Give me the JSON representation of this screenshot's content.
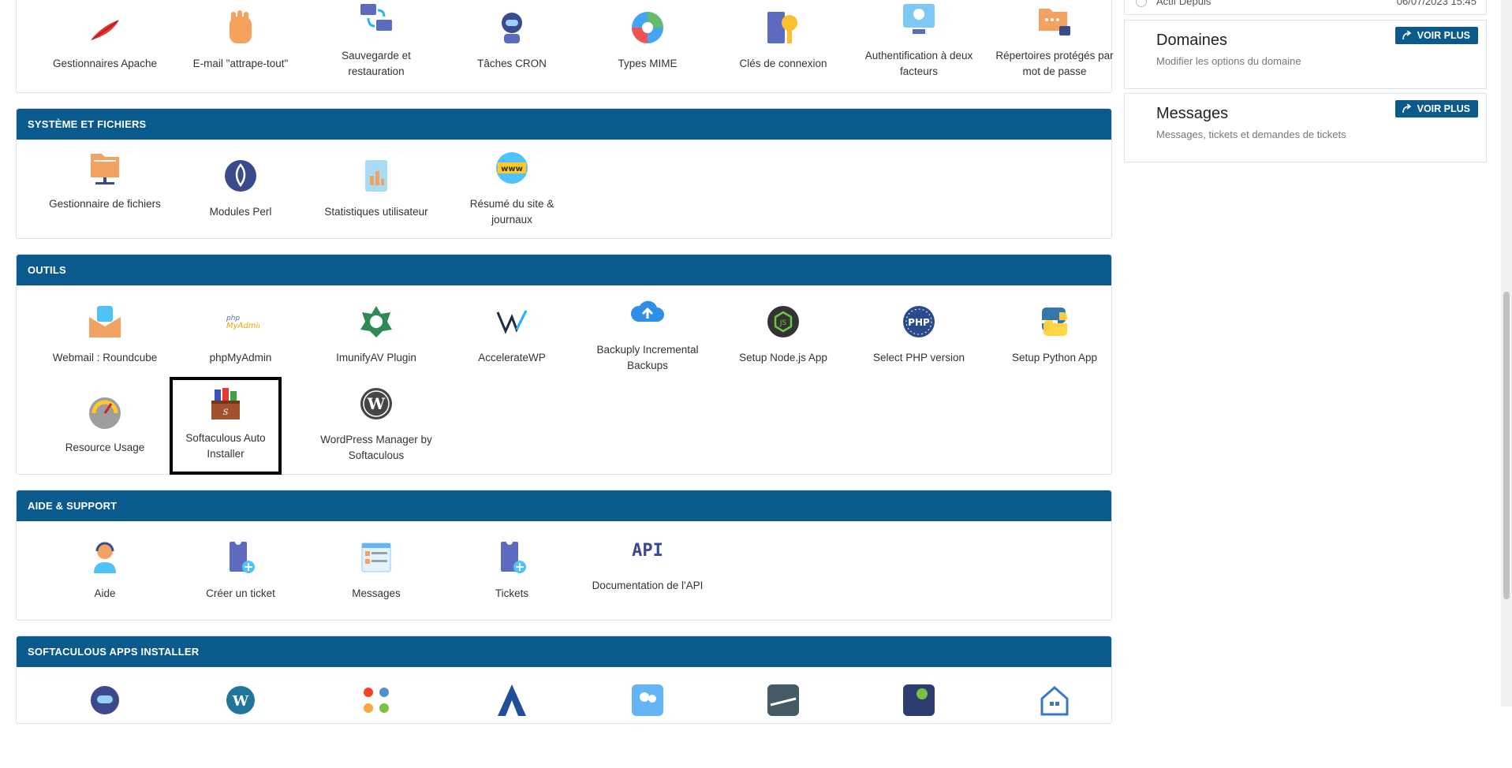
{
  "sections": [
    {
      "header": "",
      "tiles": [
        {
          "label": "Gestionnaires Apache",
          "icon": "feather-icon"
        },
        {
          "label": "E-mail \"attrape-tout\"",
          "icon": "hand-icon"
        },
        {
          "label": "Sauvegarde et restauration",
          "icon": "backup-icon"
        },
        {
          "label": "Tâches CRON",
          "icon": "robot-icon"
        },
        {
          "label": "Types MIME",
          "icon": "mime-icon"
        },
        {
          "label": "Clés de connexion",
          "icon": "key-icon"
        },
        {
          "label": "Authentification à deux facteurs",
          "icon": "two-factor-icon"
        },
        {
          "label": "Répertoires protégés par mot de passe",
          "icon": "locked-folder-icon"
        }
      ]
    },
    {
      "header": "SYSTÈME ET FICHIERS",
      "tiles": [
        {
          "label": "Gestionnaire de fichiers",
          "icon": "file-manager-icon"
        },
        {
          "label": "Modules Perl",
          "icon": "perl-onion-icon"
        },
        {
          "label": "Statistiques utilisateur",
          "icon": "stats-icon"
        },
        {
          "label": "Résumé du site & journaux",
          "icon": "www-globe-icon"
        }
      ]
    },
    {
      "header": "OUTILS",
      "tiles": [
        {
          "label": "Webmail : Roundcube",
          "icon": "roundcube-icon"
        },
        {
          "label": "phpMyAdmin",
          "icon": "phpmyadmin-icon"
        },
        {
          "label": "ImunifyAV Plugin",
          "icon": "imunify-icon"
        },
        {
          "label": "AccelerateWP",
          "icon": "acceleratewp-icon"
        },
        {
          "label": "Backuply Incremental Backups",
          "icon": "cloud-upload-icon"
        },
        {
          "label": "Setup Node.js App",
          "icon": "nodejs-icon"
        },
        {
          "label": "Select PHP version",
          "icon": "php-icon"
        },
        {
          "label": "Setup Python App",
          "icon": "python-icon"
        },
        {
          "label": "Resource Usage",
          "icon": "gauge-icon"
        },
        {
          "label": "Softaculous Auto Installer",
          "icon": "softaculous-icon"
        },
        {
          "label": "WordPress Manager by Softaculous",
          "icon": "wordpress-icon"
        }
      ]
    },
    {
      "header": "AIDE & SUPPORT",
      "tiles": [
        {
          "label": "Aide",
          "icon": "support-agent-icon"
        },
        {
          "label": "Créer un ticket",
          "icon": "ticket-add-icon"
        },
        {
          "label": "Messages",
          "icon": "messages-icon"
        },
        {
          "label": "Tickets",
          "icon": "tickets-icon"
        },
        {
          "label": "Documentation de l'API",
          "icon": "api-icon"
        }
      ]
    },
    {
      "header": "SOFTACULOUS APPS INSTALLER",
      "tiles": [
        {
          "label": "",
          "icon": "bot-app-icon"
        },
        {
          "label": "",
          "icon": "wordpress-app-icon"
        },
        {
          "label": "",
          "icon": "joomla-icon"
        },
        {
          "label": "",
          "icon": "abantecart-icon"
        },
        {
          "label": "",
          "icon": "users-app-icon"
        },
        {
          "label": "",
          "icon": "seesaw-app-icon"
        },
        {
          "label": "",
          "icon": "whmcs-icon"
        },
        {
          "label": "",
          "icon": "house-app-icon"
        }
      ]
    }
  ],
  "right": {
    "top_partial": {
      "label": "Actif Depuis",
      "value": "06/07/2023 15:45"
    },
    "cards": [
      {
        "title": "Domaines",
        "sub": "Modifier les options du domaine",
        "button": "VOIR PLUS"
      },
      {
        "title": "Messages",
        "sub": "Messages, tickets et demandes de tickets",
        "button": "VOIR PLUS"
      }
    ]
  },
  "colors": {
    "header": "#0a5a8e",
    "button": "#0a5a8e"
  }
}
